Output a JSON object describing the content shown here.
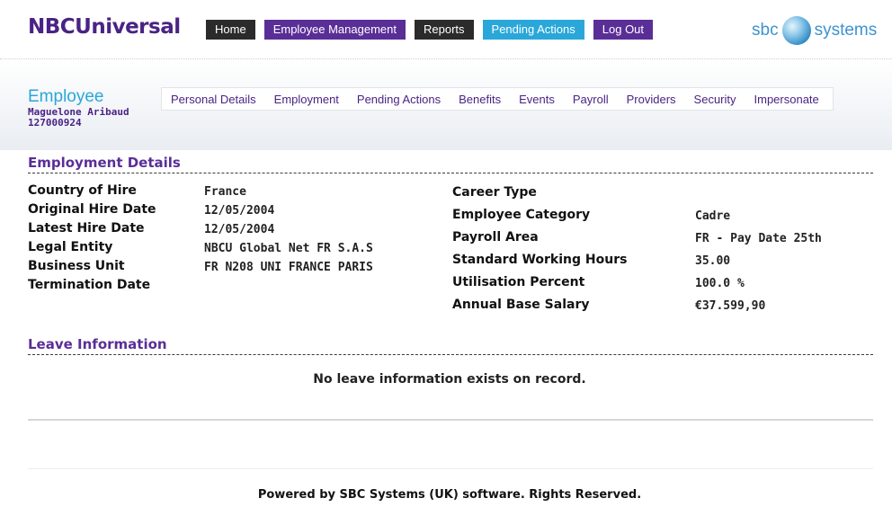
{
  "header": {
    "logo": "NBCUniversal",
    "nav": [
      {
        "label": "Home",
        "style": "dark"
      },
      {
        "label": "Employee Management",
        "style": "purple"
      },
      {
        "label": "Reports",
        "style": "dark"
      },
      {
        "label": "Pending Actions",
        "style": "cyan"
      },
      {
        "label": "Log Out",
        "style": "purple"
      }
    ],
    "brand_left": "sbc",
    "brand_right": "systems"
  },
  "employee": {
    "title": "Employee",
    "name": "Maguelone Aribaud",
    "id": "127000924"
  },
  "tabs": [
    "Personal Details",
    "Employment",
    "Pending Actions",
    "Benefits",
    "Events",
    "Payroll",
    "Providers",
    "Security",
    "Impersonate"
  ],
  "employment": {
    "title": "Employment Details",
    "left": [
      {
        "label": "Country of Hire",
        "value": "France"
      },
      {
        "label": "Original Hire Date",
        "value": "12/05/2004"
      },
      {
        "label": "Latest Hire Date",
        "value": "12/05/2004"
      },
      {
        "label": "Legal Entity",
        "value": "NBCU Global Net FR S.A.S"
      },
      {
        "label": "Business Unit",
        "value": "FR N208 UNI FRANCE PARIS"
      },
      {
        "label": "Termination Date",
        "value": ""
      }
    ],
    "right": [
      {
        "label": "Career Type",
        "value": ""
      },
      {
        "label": "Employee Category",
        "value": "Cadre"
      },
      {
        "label": "Payroll Area",
        "value": "FR - Pay Date 25th"
      },
      {
        "label": "Standard Working Hours",
        "value": "35.00"
      },
      {
        "label": "Utilisation Percent",
        "value": "100.0 %"
      },
      {
        "label": "Annual Base Salary",
        "value": "€37.599,90"
      }
    ]
  },
  "leave": {
    "title": "Leave Information",
    "message": "No leave information exists on record."
  },
  "footer": "Powered by SBC Systems (UK) software. Rights Reserved.",
  "colors": {
    "purple": "#5a2e97",
    "cyan": "#2aa7d9",
    "dark": "#2b2b2b"
  }
}
